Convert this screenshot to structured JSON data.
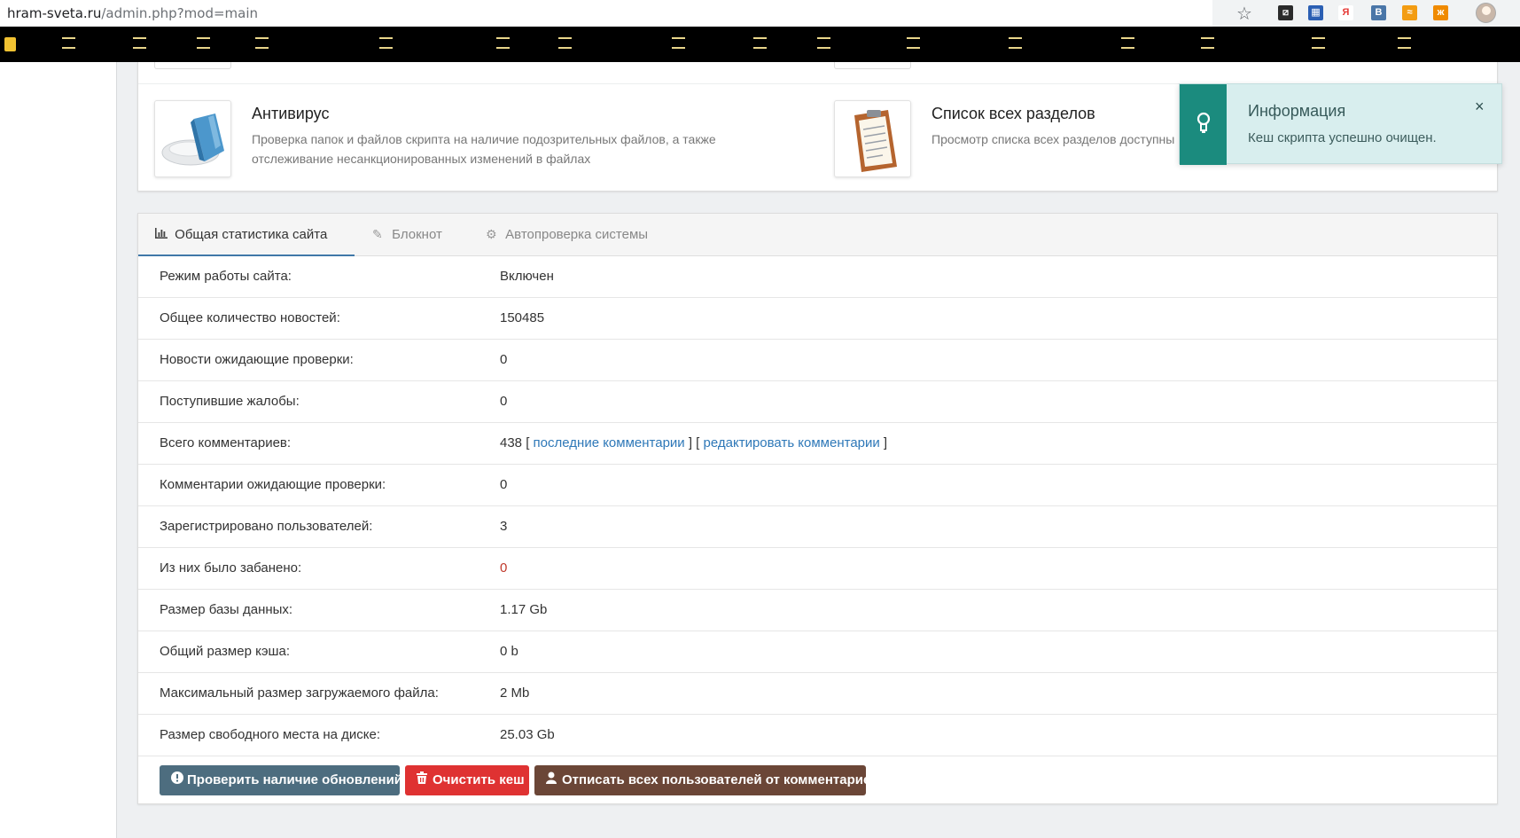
{
  "browser": {
    "url_host": "hram-sveta.ru",
    "url_path": "/admin.php?mod=main",
    "extensions": [
      {
        "name": "ext-icon-1",
        "color": "#2b2b2b",
        "glyph": "⧄"
      },
      {
        "name": "ext-icon-2",
        "color": "#2b5fb3",
        "glyph": "▦"
      },
      {
        "name": "yandex-icon",
        "color": "#e53935",
        "glyph": "Я"
      },
      {
        "name": "vk-icon",
        "color": "#4a76a8",
        "glyph": "В"
      },
      {
        "name": "rss-icon",
        "color": "#f39c12",
        "glyph": "≈"
      },
      {
        "name": "odnoklassniki-icon",
        "color": "#f08a00",
        "glyph": "ж"
      }
    ]
  },
  "modules": [
    {
      "title": "Антивирус",
      "desc_line1": "Проверка папок и файлов скрипта на наличие подозрительных файлов, а также",
      "desc_line2": "отслеживание несанкционированных изменений в файлах"
    },
    {
      "title": "Список всех разделов",
      "desc_line1": "Просмотр списка всех разделов доступны"
    }
  ],
  "notification": {
    "title": "Информация",
    "message": "Кеш скрипта успешно очищен.",
    "close": "×",
    "color": "#1b8b7e"
  },
  "tabs": [
    {
      "label": "Общая статистика сайта",
      "icon": "chart-icon",
      "active": true
    },
    {
      "label": "Блокнот",
      "icon": "edit-icon",
      "active": false
    },
    {
      "label": "Автопроверка системы",
      "icon": "gear-icon",
      "active": false
    }
  ],
  "stats": {
    "mode": {
      "label": "Режим работы сайта:",
      "value": "Включен"
    },
    "news_total": {
      "label": "Общее количество новостей:",
      "value": "150485"
    },
    "news_pending": {
      "label": "Новости ожидающие проверки:",
      "value": "0"
    },
    "complaints": {
      "label": "Поступившие жалобы:",
      "value": "0"
    },
    "comments_total": {
      "label": "Всего комментариев:",
      "value": "438",
      "link_last": "последние комментарии",
      "link_edit": "редактировать комментарии"
    },
    "comments_pending": {
      "label": "Комментарии ожидающие проверки:",
      "value": "0"
    },
    "users_registered": {
      "label": "Зарегистрировано пользователей:",
      "value": "3"
    },
    "users_banned": {
      "label": "Из них было забанено:",
      "value": "0"
    },
    "db_size": {
      "label": "Размер базы данных:",
      "value": "1.17 Gb"
    },
    "cache_size": {
      "label": "Общий размер кэша:",
      "value": "0 b"
    },
    "max_upload": {
      "label": "Максимальный размер загружаемого файла:",
      "value": "2 Mb"
    },
    "disk_free": {
      "label": "Размер свободного места на диске:",
      "value": "25.03 Gb"
    }
  },
  "buttons": {
    "check_updates": "Проверить наличие обновлений",
    "clear_cache": "Очистить кеш",
    "unsubscribe": "Отписать всех пользователей от комментариев"
  }
}
